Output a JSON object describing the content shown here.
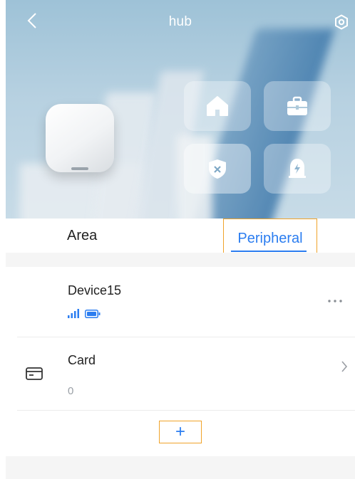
{
  "header": {
    "title": "hub",
    "back_icon": "chevron-left-icon",
    "settings_icon": "settings-circle-icon"
  },
  "modes": [
    {
      "name": "home",
      "icon": "house-icon"
    },
    {
      "name": "away",
      "icon": "briefcase-icon"
    },
    {
      "name": "disarm",
      "icon": "shield-x-icon"
    },
    {
      "name": "panic",
      "icon": "bell-bolt-icon"
    }
  ],
  "tabs": {
    "area": "Area",
    "peripheral": "Peripheral",
    "selected": "Peripheral"
  },
  "list": {
    "device": {
      "name": "Device15",
      "signal_icon": "signal-bars-icon",
      "battery_icon": "battery-icon",
      "more_icon": "more-dots-icon"
    },
    "card": {
      "name": "Card",
      "count": "0",
      "icon": "card-icon",
      "chevron_icon": "chevron-right-icon"
    },
    "add_label": "+"
  },
  "colors": {
    "accent": "#2b7df0",
    "highlight": "#f0a32a"
  }
}
